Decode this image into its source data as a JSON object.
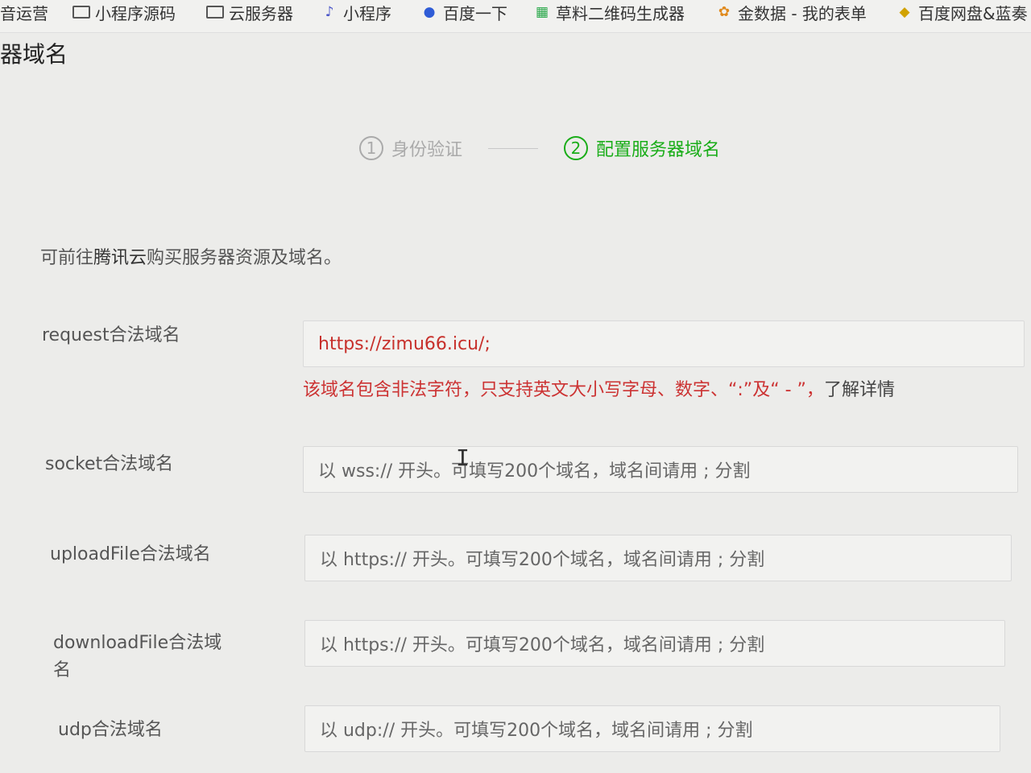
{
  "bookmarks": [
    {
      "label": "音运营",
      "icon": "folder-icon"
    },
    {
      "label": "小程序源码",
      "icon": "folder-icon"
    },
    {
      "label": "云服务器",
      "icon": "folder-icon"
    },
    {
      "label": "小程序",
      "icon": "music-note-icon"
    },
    {
      "label": "百度一下",
      "icon": "baidu-paw-icon"
    },
    {
      "label": "草料二维码生成器",
      "icon": "qr-icon"
    },
    {
      "label": "金数据 - 我的表单",
      "icon": "leaf-icon"
    },
    {
      "label": "百度网盘&蓝奏",
      "icon": "baidu-disk-icon"
    }
  ],
  "page_title": "器域名",
  "steps": [
    {
      "num": "1",
      "label": "身份验证"
    },
    {
      "num": "2",
      "label": "配置服务器域名"
    }
  ],
  "intro": {
    "prefix": "可前往",
    "link": "腾讯云",
    "suffix": "购买服务器资源及域名。"
  },
  "fields": {
    "request": {
      "label": "request合法域名",
      "value": "https://zimu66.icu/;"
    },
    "socket": {
      "label": "socket合法域名",
      "placeholder": "以 wss:// 开头。可填写200个域名，域名间请用 ; 分割"
    },
    "uploadFile": {
      "label": "uploadFile合法域名",
      "placeholder": "以 https:// 开头。可填写200个域名，域名间请用 ; 分割"
    },
    "downloadFile": {
      "label_line1": "downloadFile合法域",
      "label_line2": "名",
      "placeholder": "以 https:// 开头。可填写200个域名，域名间请用 ; 分割"
    },
    "udp": {
      "label": "udp合法域名",
      "placeholder": "以 udp:// 开头。可填写200个域名，域名间请用 ; 分割"
    }
  },
  "error": {
    "text": "该域名包含非法字符，只支持英文大小写字母、数字、“:”及“ - ”，",
    "more": "了解详情"
  },
  "colors": {
    "accent": "#1aad19",
    "error": "#cc3333"
  }
}
